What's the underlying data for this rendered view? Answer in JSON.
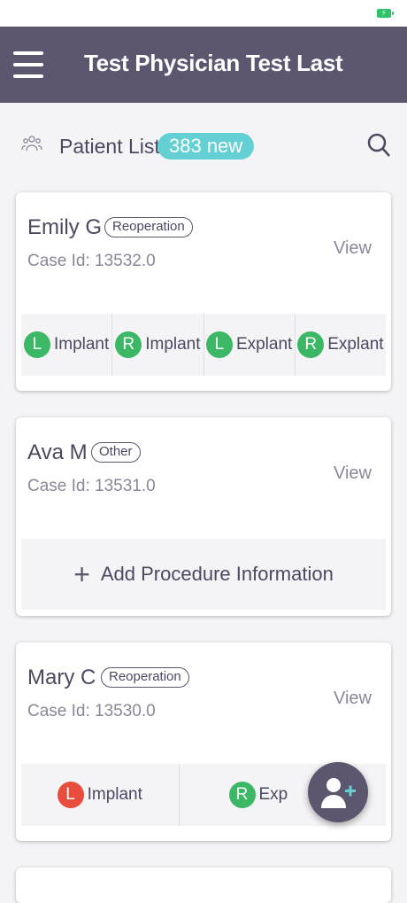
{
  "status_bar": {
    "battery_icon": "battery-charging-icon"
  },
  "header": {
    "title": "Test Physician Test Last",
    "menu_icon": "hamburger-icon"
  },
  "list": {
    "title": "Patient List",
    "new_count": "383 new",
    "users_icon": "users-icon",
    "search_icon": "search-icon"
  },
  "cards": [
    {
      "name": "Emily G",
      "tag": "Reoperation",
      "case_id": "Case Id:  13532.0",
      "view": "View",
      "procedures": [
        {
          "side": "L",
          "label": "Implant",
          "color": "#3bb765"
        },
        {
          "side": "R",
          "label": "Implant",
          "color": "#3bb765"
        },
        {
          "side": "L",
          "label": "Explant",
          "color": "#3bb765"
        },
        {
          "side": "R",
          "label": "Explant",
          "color": "#3bb765"
        }
      ]
    },
    {
      "name": "Ava M",
      "tag": "Other",
      "case_id": "Case Id:  13531.0",
      "view": "View",
      "add_procedure": "Add Procedure Information"
    },
    {
      "name": "Mary C",
      "tag": "Reoperation",
      "case_id": "Case Id:  13530.0",
      "view": "View",
      "procedures": [
        {
          "side": "L",
          "label": "Implant",
          "color": "#e84c3d"
        },
        {
          "side": "R",
          "label": "Exp",
          "color": "#3bb765"
        }
      ]
    }
  ],
  "fab": {
    "icon": "add-user-icon"
  },
  "colors": {
    "header": "#5d566f",
    "badge": "#65d0d3",
    "green": "#3bb765",
    "red": "#e84c3d"
  }
}
